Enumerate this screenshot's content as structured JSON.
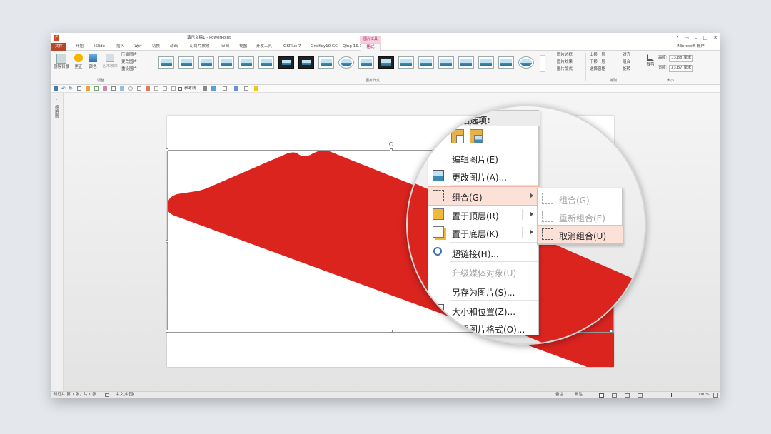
{
  "title_bar": {
    "doc_title": "演示文稿1 - PowerPoint",
    "contextual_group": "图片工具",
    "account": "Microsoft 帐户"
  },
  "tabs": [
    "文件",
    "开始",
    "iSlide",
    "插入",
    "设计",
    "切换",
    "动画",
    "幻灯片放映",
    "审阅",
    "视图",
    "开发工具",
    "OKPlus 7",
    "OneKey10 GC",
    "Qing 15.1",
    "格式"
  ],
  "ribbon": {
    "adjust": {
      "remove_bg": "删除背景",
      "correct": "更正",
      "color": "颜色",
      "art_effect": "艺术效果",
      "compress": "压缩图片",
      "change": "更改图片",
      "reset": "重设图片",
      "label": "调整"
    },
    "styles_label": "图片样式",
    "style_opts": [
      "图片边框",
      "图片效果",
      "图片版式"
    ],
    "arrange": {
      "forward": "上移一层",
      "backward": "下移一层",
      "pane": "选择窗格",
      "align": "对齐",
      "group": "组合",
      "rotate": "旋转",
      "label": "排列"
    },
    "size": {
      "crop": "裁剪",
      "height_label": "高度:",
      "height_value": "13.88 厘米",
      "width_label": "宽度:",
      "width_value": "33.87 厘米",
      "label": "大小"
    }
  },
  "qat": {
    "reference_line": "参考线"
  },
  "side_pane": {
    "label": "缩略图"
  },
  "status_bar": {
    "slide_info": "幻灯片 第 1 张，共 1 张",
    "language": "中文(中国)",
    "notes": "备注",
    "comments": "批注",
    "zoom": "100%"
  },
  "context_menu": {
    "paste_header": "粘贴选项:",
    "items": [
      {
        "label": "编辑图片(E)",
        "state": "normal"
      },
      {
        "label": "更改图片(A)...",
        "state": "normal"
      },
      {
        "label": "组合(G)",
        "state": "highlighted"
      },
      {
        "label": "置于顶层(R)",
        "state": "normal"
      },
      {
        "label": "置于底层(K)",
        "state": "normal"
      },
      {
        "label": "超链接(H)...",
        "state": "normal"
      },
      {
        "label": "升级媒体对象(U)",
        "state": "disabled"
      },
      {
        "label": "另存为图片(S)...",
        "state": "normal"
      },
      {
        "label": "大小和位置(Z)...",
        "state": "normal"
      },
      {
        "label": "设置图片格式(O)...",
        "state": "normal"
      }
    ]
  },
  "group_submenu": {
    "items": [
      {
        "label": "组合(G)",
        "state": "disabled"
      },
      {
        "label": "重新组合(E)",
        "state": "disabled"
      },
      {
        "label": "取消组合(U)",
        "state": "highlighted"
      }
    ]
  },
  "colors": {
    "shape_red": "#dc241f",
    "ppt_orange": "#b7472a",
    "format_tab": "#b0306a",
    "highlight": "#fbe1d8"
  }
}
